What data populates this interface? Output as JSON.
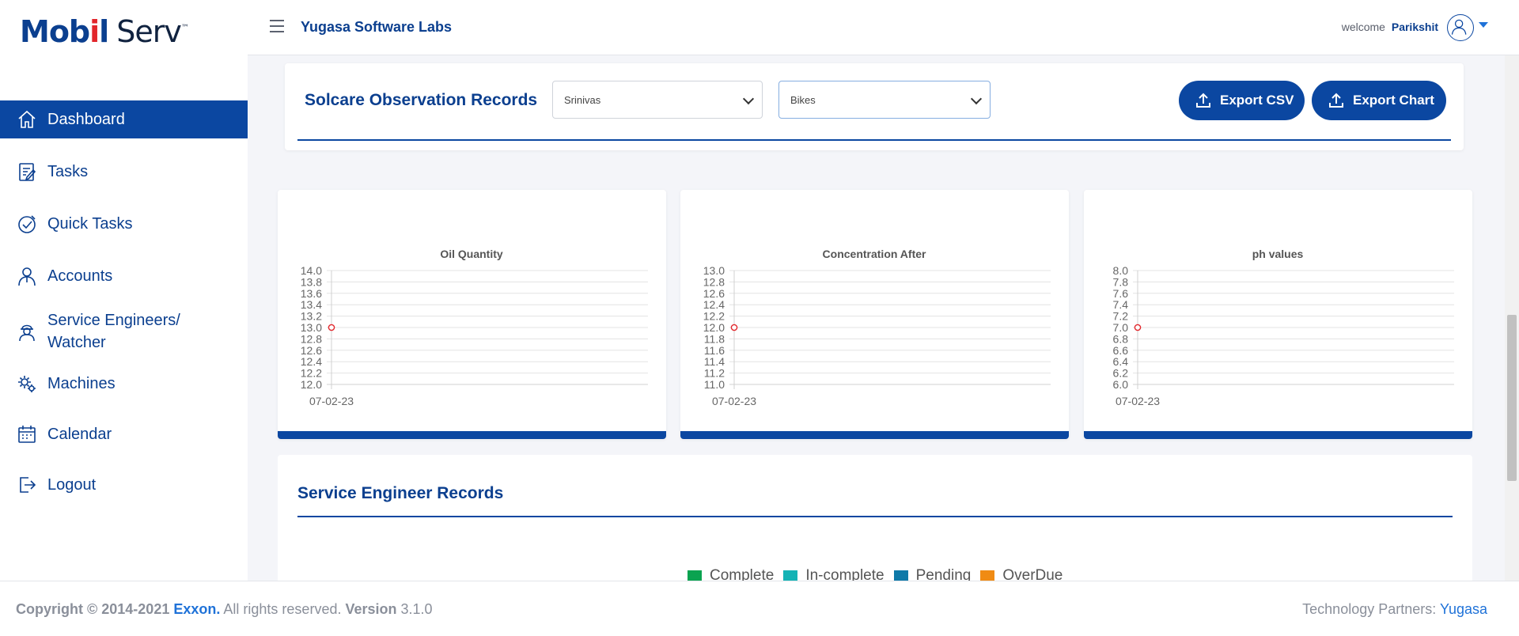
{
  "brand": {
    "logo_mobil": "Mobil",
    "logo_serv": "Serv",
    "logo_tm": "™"
  },
  "header": {
    "company": "Yugasa Software Labs",
    "welcome": "welcome",
    "user": "Parikshit"
  },
  "sidebar": {
    "items": [
      {
        "label": "Dashboard",
        "icon": "home-icon",
        "active": true
      },
      {
        "label": "Tasks",
        "icon": "tasks-icon"
      },
      {
        "label": "Quick Tasks",
        "icon": "quick-tasks-icon"
      },
      {
        "label": "Accounts",
        "icon": "accounts-icon"
      },
      {
        "label": "Service Engineers/ Watcher",
        "icon": "service-engineer-icon"
      },
      {
        "label": "Machines",
        "icon": "machines-icon"
      },
      {
        "label": "Calendar",
        "icon": "calendar-icon"
      },
      {
        "label": "Logout",
        "icon": "logout-icon"
      }
    ]
  },
  "records": {
    "title": "Solcare Observation Records",
    "select1": "Srinivas",
    "select2": "Bikes",
    "export_csv": "Export CSV",
    "export_chart": "Export Chart"
  },
  "chart_data": [
    {
      "type": "line",
      "title": "Oil Quantity",
      "categories": [
        "07-02-23"
      ],
      "values": [
        13.0
      ],
      "ylim": [
        12.0,
        14.0
      ],
      "yticks": [
        "14.0",
        "13.8",
        "13.6",
        "13.4",
        "13.2",
        "13.0",
        "12.8",
        "12.6",
        "12.4",
        "12.2",
        "12.0"
      ],
      "grid": true,
      "point_color": "#e2262b"
    },
    {
      "type": "line",
      "title": "Concentration After",
      "categories": [
        "07-02-23"
      ],
      "values": [
        12.0
      ],
      "ylim": [
        11.0,
        13.0
      ],
      "yticks": [
        "13.0",
        "12.8",
        "12.6",
        "12.4",
        "12.2",
        "12.0",
        "11.8",
        "11.6",
        "11.4",
        "11.2",
        "11.0"
      ],
      "grid": true,
      "point_color": "#e2262b"
    },
    {
      "type": "line",
      "title": "ph values",
      "categories": [
        "07-02-23"
      ],
      "values": [
        7.0
      ],
      "ylim": [
        6.0,
        8.0
      ],
      "yticks": [
        "8.0",
        "7.8",
        "7.6",
        "7.4",
        "7.2",
        "7.0",
        "6.8",
        "6.6",
        "6.4",
        "6.2",
        "6.0"
      ],
      "grid": true,
      "point_color": "#e2262b"
    }
  ],
  "service_engineer": {
    "title": "Service Engineer Records",
    "legend": [
      {
        "label": "Complete",
        "color": "#0aa350"
      },
      {
        "label": "In-complete",
        "color": "#14b3b5"
      },
      {
        "label": "Pending",
        "color": "#0e79a8"
      },
      {
        "label": "OverDue",
        "color": "#f08b14"
      }
    ]
  },
  "footer": {
    "copyright": "Copyright © 2014-2021",
    "company": "Exxon.",
    "rights": "All rights reserved.",
    "version_label": "Version",
    "version": "3.1.0",
    "partners": "Technology Partners:",
    "partner_link": "Yugasa"
  },
  "colors": {
    "primary": "#0b47a1",
    "accent": "#1f72d8",
    "brand_red": "#e2262b"
  }
}
